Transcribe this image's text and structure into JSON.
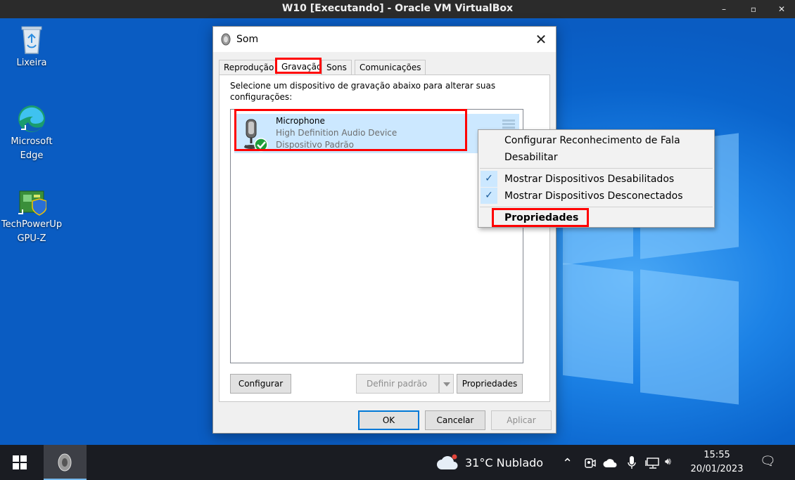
{
  "vbox": {
    "title": "W10 [Executando] - Oracle VM VirtualBox",
    "min_glyph": "–",
    "max_glyph": "▫",
    "close_glyph": "✕"
  },
  "desktop_icons": [
    {
      "label_1": "Lixeira"
    },
    {
      "label_1": "Microsoft",
      "label_2": "Edge"
    },
    {
      "label_1": "TechPowerUp",
      "label_2": "GPU-Z"
    }
  ],
  "dialog": {
    "title": "Som",
    "close_glyph": "✕",
    "tabs": [
      "Reprodução",
      "Gravação",
      "Sons",
      "Comunicações"
    ],
    "instructions": "Selecione um dispositivo de gravação abaixo para alterar suas configurações:",
    "device": {
      "name": "Microphone",
      "driver": "High Definition Audio Device",
      "status": "Dispositivo Padrão"
    },
    "buttons": {
      "configure": "Configurar",
      "set_default": "Definir padrão",
      "properties": "Propriedades",
      "ok": "OK",
      "cancel": "Cancelar",
      "apply": "Aplicar"
    }
  },
  "context_menu": {
    "items": [
      "Configurar Reconhecimento de Fala",
      "Desabilitar",
      "Mostrar Dispositivos Desabilitados",
      "Mostrar Dispositivos Desconectados",
      "Propriedades"
    ],
    "check_glyph": "✓"
  },
  "taskbar": {
    "weather": "31°C  Nublado",
    "time": "15:55",
    "date": "20/01/2023",
    "tray_up_glyph": "⌃",
    "speaker_glyph": "🔊︎",
    "notification_glyph": "🗨︎"
  },
  "colors": {
    "highlight_red": "#ff0000",
    "selection_blue": "#cce8ff",
    "desktop_blue": "#0a64cc",
    "taskbar": "#1a1c22"
  }
}
